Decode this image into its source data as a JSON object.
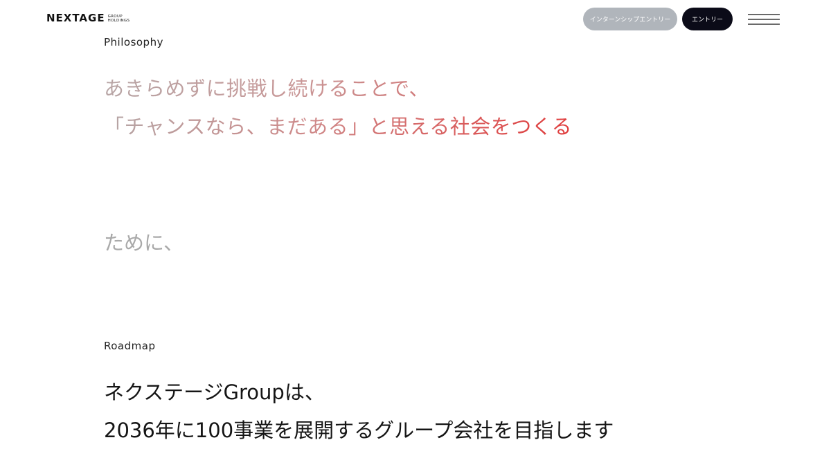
{
  "header": {
    "logo_main": "NEXTAGE",
    "logo_sub_1": "GROUP",
    "logo_sub_2": "HOLDINGS",
    "intern_button_label": "インターンシップエントリー",
    "entry_button_label": "エントリー",
    "menu_icon": "hamburger-menu-icon"
  },
  "philosophy": {
    "label": "Philosophy",
    "line_1": "あきらめずに挑戦し続けることで、",
    "line_2": "「チャンスなら、まだある」と思える社会をつくる",
    "line_3": "ために、"
  },
  "roadmap": {
    "label": "Roadmap",
    "line_1": "ネクステージGroupは、",
    "line_2": "2036年に100事業を展開するグループ会社を目指します"
  },
  "colors": {
    "intern_button_bg": "#b0b5bb",
    "entry_button_bg": "#0b0b18",
    "accent_red": "#e03c3c"
  }
}
